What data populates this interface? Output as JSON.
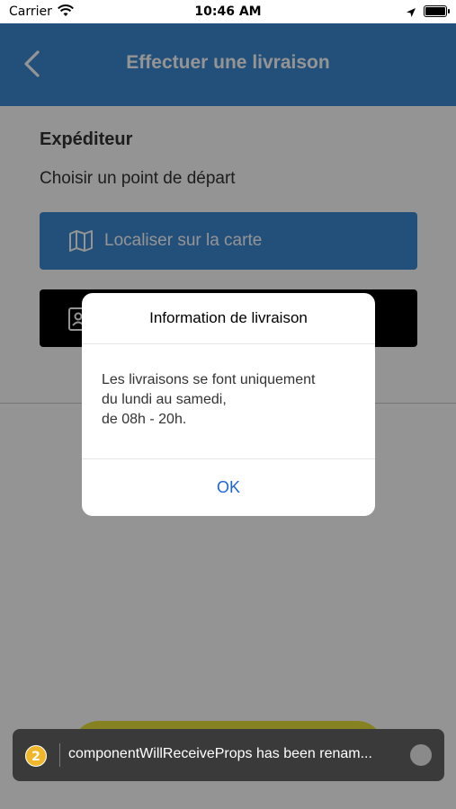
{
  "status_bar": {
    "carrier": "Carrier",
    "time": "10:46 AM"
  },
  "header": {
    "title": "Effectuer une livraison",
    "back_icon": "chevron-left-icon"
  },
  "sender": {
    "title": "Expéditeur",
    "subtitle": "Choisir un point de départ",
    "map_button": {
      "label": "Localiser sur la carte",
      "icon": "map-icon"
    },
    "contact_button": {
      "icon": "contact-card-icon"
    }
  },
  "dialog": {
    "title": "Information de livraison",
    "message_lines": [
      "Les livraisons se font uniquement",
      "du lundi au samedi,",
      "de 08h - 20h."
    ],
    "ok_label": "OK"
  },
  "toast": {
    "count": "2",
    "message": "componentWillReceiveProps has been renam..."
  },
  "colors": {
    "primary": "#3d8bd3",
    "dialog_button": "#1e66d4",
    "badge": "#f0b72a",
    "accent_button": "#e8e03a"
  }
}
